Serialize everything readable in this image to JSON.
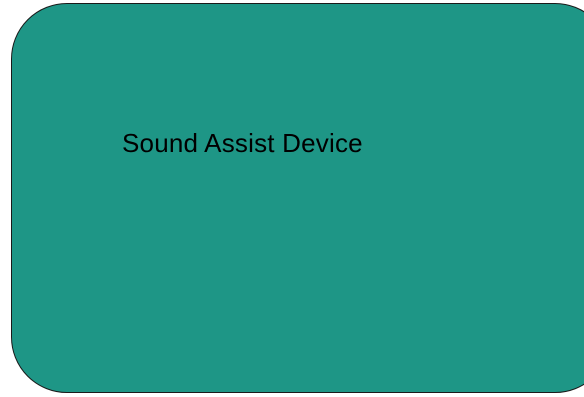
{
  "shape": {
    "label": "Sound Assist Device",
    "fill_color": "#1e9686",
    "border_color": "#1a1a1a",
    "text_color": "#000000"
  }
}
